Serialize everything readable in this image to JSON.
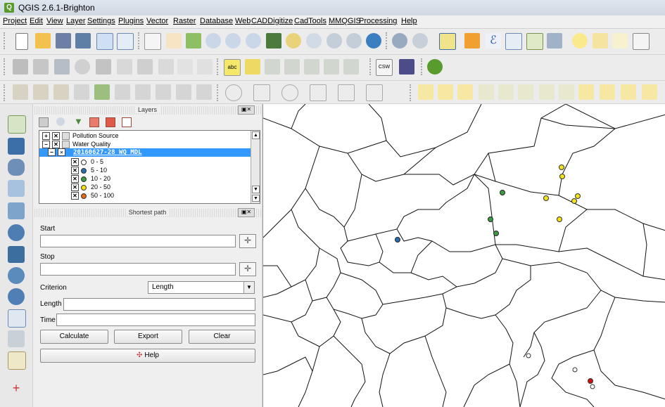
{
  "window": {
    "title": "QGIS 2.6.1-Brighton"
  },
  "menu": [
    "Project",
    "Edit",
    "View",
    "Layer",
    "Settings",
    "Plugins",
    "Vector",
    "Raster",
    "Database",
    "Web",
    "CADDigitize",
    "CadTools",
    "MMQGIS",
    "Processing",
    "Help"
  ],
  "layers_panel": {
    "title": "Layers",
    "items": [
      {
        "label": "Pollution Source"
      },
      {
        "label": "Water Quality"
      },
      {
        "label": "20160627-28 WQ MDL"
      },
      {
        "label": "0 - 5",
        "color": "#ffffff"
      },
      {
        "label": "5 - 10",
        "color": "#2a6fa8"
      },
      {
        "label": "10 - 20",
        "color": "#3f9a45"
      },
      {
        "label": "20 - 50",
        "color": "#f2e21b"
      },
      {
        "label": "50 - 100",
        "color": "#e06c1c"
      }
    ]
  },
  "shortest_path": {
    "title": "Shortest path",
    "start_label": "Start",
    "stop_label": "Stop",
    "criterion_label": "Criterion",
    "criterion_value": "Length",
    "length_label": "Length",
    "time_label": "Time",
    "calculate": "Calculate",
    "export": "Export",
    "clear": "Clear",
    "help": "Help"
  },
  "map_points": [
    {
      "class": "5 - 10",
      "color": "#2a6fa8"
    },
    {
      "class": "10 - 20",
      "color": "#3f9a45"
    },
    {
      "class": "20 - 50",
      "color": "#f2e21b"
    },
    {
      "class": "0 - 5",
      "color": "#ffffff"
    },
    {
      "class": "high",
      "color": "#cc1111"
    }
  ]
}
